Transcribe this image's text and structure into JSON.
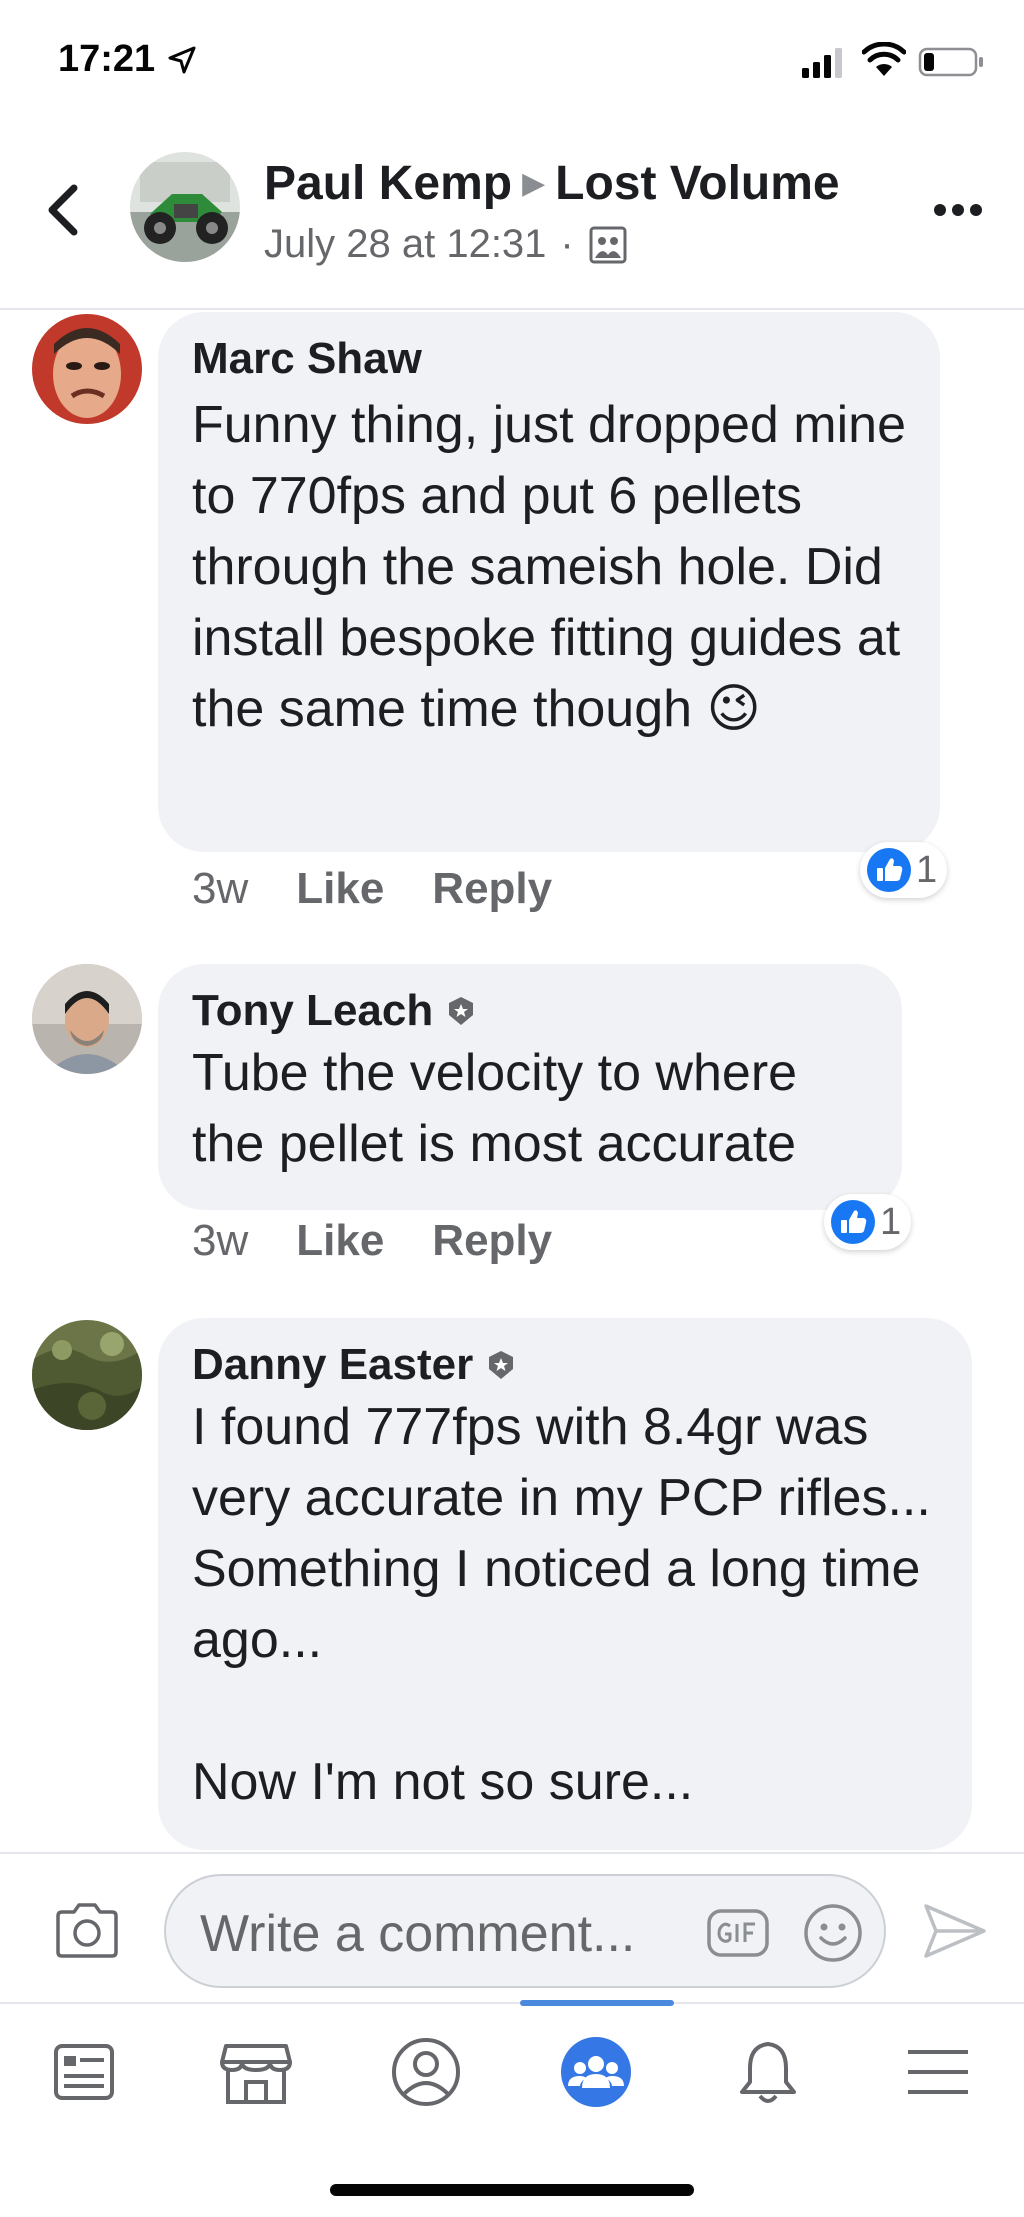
{
  "status_bar": {
    "time": "17:21"
  },
  "header": {
    "author": "Paul Kemp",
    "group": "Lost Volume",
    "timestamp": "July 28 at 12:31",
    "separator": "·"
  },
  "comments": [
    {
      "author": "Marc Shaw",
      "text": "Funny thing, just dropped mine to 770fps and put 6 pellets through the sameish hole. Did install bespoke fitting guides at the same time though 😉",
      "age": "3w",
      "like_label": "Like",
      "reply_label": "Reply",
      "like_count": "1"
    },
    {
      "author": "Tony Leach",
      "text": "Tube the velocity to where the pellet is most accurate",
      "age": "3w",
      "like_label": "Like",
      "reply_label": "Reply",
      "like_count": "1"
    },
    {
      "author": "Danny Easter",
      "text": "I found 777fps with 8.4gr was very accurate in my PCP rifles... Something I noticed a long time ago...\n\nNow I'm not so sure..."
    }
  ],
  "composer": {
    "placeholder": "Write a comment..."
  },
  "colors": {
    "accent": "#1877f2",
    "bubble": "#f0f2f5",
    "text": "#1c1e21",
    "secondary": "#65676b",
    "tab_active": "#4a89dc"
  },
  "icons": {
    "back": "chevron-left-icon",
    "more": "more-icon",
    "camera": "camera-icon",
    "gif": "gif-icon",
    "emoji": "smile-icon",
    "send": "send-icon",
    "tabs": [
      "news-feed-icon",
      "marketplace-icon",
      "profile-icon",
      "groups-icon",
      "notifications-icon",
      "menu-icon"
    ]
  }
}
